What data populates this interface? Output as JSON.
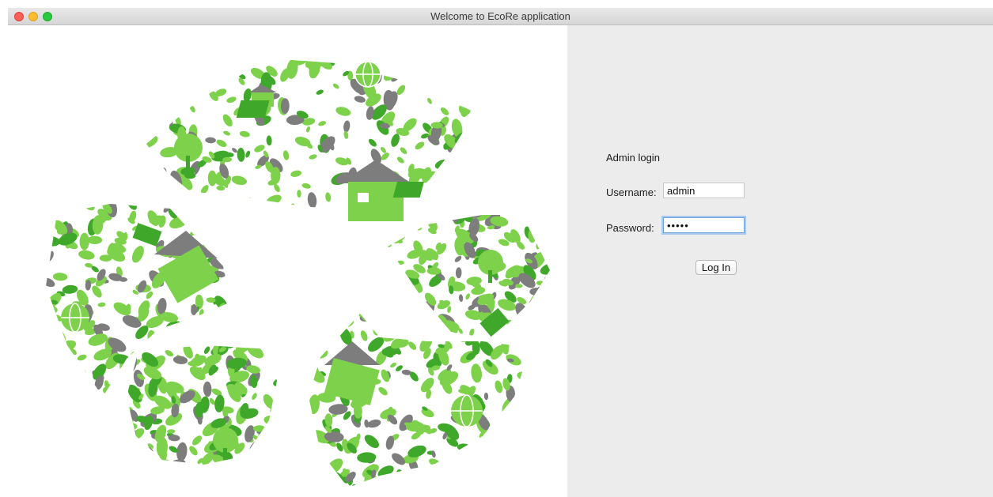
{
  "window": {
    "title": "Welcome to EcoRe application"
  },
  "image_panel": {
    "description_icon": "eco-recycle-symbol-icon",
    "colors": {
      "light_green": "#7ed14b",
      "dark_green": "#3fa82a",
      "grey": "#7d7d7d"
    }
  },
  "login": {
    "title": "Admin login",
    "username_label": "Username:",
    "username_value": "admin",
    "password_label": "Password:",
    "password_value": "admin",
    "button_label": "Log In"
  },
  "colors": {
    "panel_background": "#ececec",
    "focus_ring": "#6fa3df"
  }
}
